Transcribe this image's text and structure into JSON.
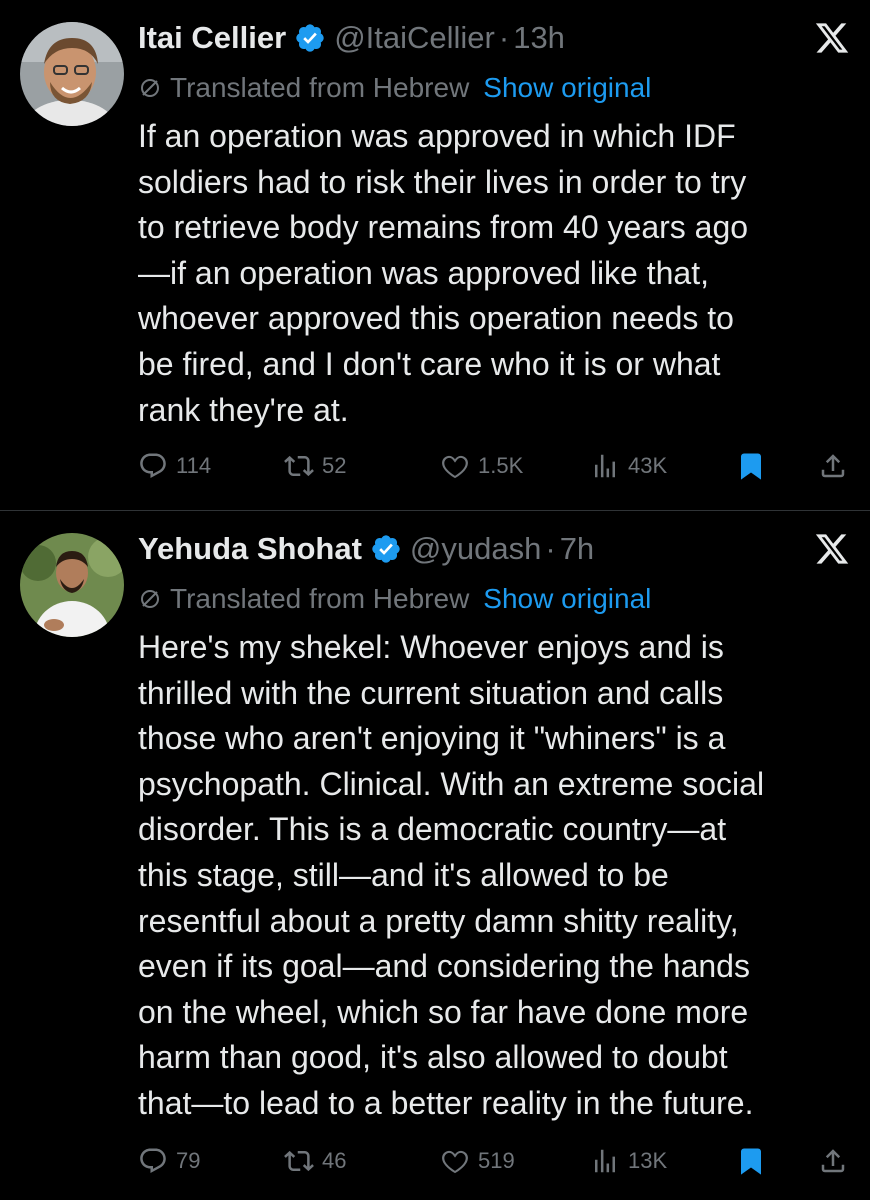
{
  "tweets": [
    {
      "name": "Itai Cellier",
      "handle": "@ItaiCellier",
      "dot": "·",
      "time": "13h",
      "translated_label": "Translated from Hebrew",
      "show_original": "Show original",
      "body_lines": [
        "If an operation was approved in which IDF",
        "soldiers had to risk their lives in order to try",
        "to retrieve body remains from 40 years ago",
        "—if an operation was approved like that,",
        "whoever approved this operation needs to",
        "be fired, and I don't care who it is or what",
        "rank they're at."
      ],
      "stats": {
        "replies": "114",
        "reposts": "52",
        "likes": "1.5K",
        "views": "43K"
      },
      "avatar_colors": {
        "bg": "#9aa0a3",
        "skin": "#c9946f",
        "hair": "#6b4a2f",
        "shirt": "#e8e8e8"
      }
    },
    {
      "name": "Yehuda Shohat",
      "handle": "@yudash",
      "dot": "·",
      "time": "7h",
      "translated_label": "Translated from Hebrew",
      "show_original": "Show original",
      "body_lines": [
        "Here's my shekel: Whoever enjoys and is",
        "thrilled with the current situation and calls",
        "those who aren't enjoying it \"whiners\" is a",
        "psychopath. Clinical. With an extreme social",
        "disorder. This is a democratic country—at",
        "this stage, still—and it's allowed to be",
        "resentful about a pretty damn shitty reality,",
        "even if its goal—and considering the hands",
        "on the wheel, which so far have done more",
        "harm than good, it's also allowed to doubt",
        "that—to lead to a better reality in the future."
      ],
      "stats": {
        "replies": "79",
        "reposts": "46",
        "likes": "519",
        "views": "13K"
      },
      "avatar_colors": {
        "bg": "#6f8a4e",
        "skin": "#b07d5b",
        "hair": "#2a1c12",
        "shirt": "#f2f2f2"
      }
    }
  ],
  "colors": {
    "background": "#000000",
    "text": "#e7e9ea",
    "secondary": "#71767b",
    "link": "#1d9bf0",
    "verified": "#1d9bf0",
    "bookmark_active": "#1d9bf0",
    "divider": "#2f3336"
  },
  "icons": [
    "verified-icon",
    "x-logo-icon",
    "translate-icon",
    "reply-icon",
    "repost-icon",
    "like-icon",
    "views-icon",
    "bookmark-icon",
    "share-icon"
  ]
}
